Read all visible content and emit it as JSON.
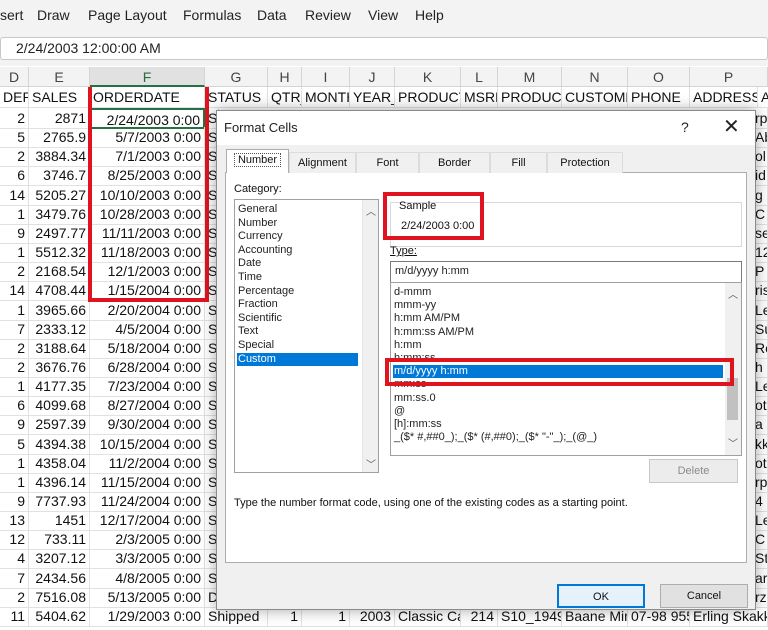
{
  "menu": [
    "sert",
    "Draw",
    "Page Layout",
    "Formulas",
    "Data",
    "Review",
    "View",
    "Help"
  ],
  "formula_bar": {
    "value": "2/24/2003 12:00:00 AM"
  },
  "columns": [
    "D",
    "E",
    "F",
    "G",
    "H",
    "I",
    "J",
    "K",
    "L",
    "M",
    "N",
    "O",
    "P"
  ],
  "headers": [
    "DER",
    "SALES",
    "ORDERDATE",
    "STATUS",
    "QTR_",
    "MONTH",
    "YEAR_II",
    "PRODUCTI",
    "MSRP",
    "PRODUCTC",
    "CUSTOMEI",
    "PHONE",
    "ADDRESSL",
    "A"
  ],
  "rows": [
    {
      "d": "2",
      "e": "2871",
      "f": "2/24/2003 0:00",
      "g": "S",
      "p": "rp"
    },
    {
      "d": "5",
      "e": "2765.9",
      "f": "5/7/2003 0:00",
      "g": "S",
      "p": "Ab"
    },
    {
      "d": "2",
      "e": "3884.34",
      "f": "7/1/2003 0:00",
      "g": "S",
      "p": "ol"
    },
    {
      "d": "6",
      "e": "3746.7",
      "f": "8/25/2003 0:00",
      "g": "S",
      "p": "id"
    },
    {
      "d": "14",
      "e": "5205.27",
      "f": "10/10/2003 0:00",
      "g": "S",
      "p": "g S"
    },
    {
      "d": "1",
      "e": "3479.76",
      "f": "10/28/2003 0:00",
      "g": "S",
      "p": "C"
    },
    {
      "d": "9",
      "e": "2497.77",
      "f": "11/11/2003 0:00",
      "g": "S",
      "p": "se"
    },
    {
      "d": "1",
      "e": "5512.32",
      "f": "11/18/2003 0:00",
      "g": "S",
      "p": "12"
    },
    {
      "d": "2",
      "e": "2168.54",
      "f": "12/1/2003 0:00",
      "g": "S",
      "p": "P"
    },
    {
      "d": "14",
      "e": "4708.44",
      "f": "1/15/2004 0:00",
      "g": "S",
      "p": "ris"
    },
    {
      "d": "1",
      "e": "3965.66",
      "f": "2/20/2004 0:00",
      "g": "S",
      "p": "Le"
    },
    {
      "d": "7",
      "e": "2333.12",
      "f": "4/5/2004 0:00",
      "g": "S",
      "p": "Su"
    },
    {
      "d": "2",
      "e": "3188.64",
      "f": "5/18/2004 0:00",
      "g": "S",
      "p": "Re"
    },
    {
      "d": "2",
      "e": "3676.76",
      "f": "6/28/2004 0:00",
      "g": "S",
      "p": "h"
    },
    {
      "d": "1",
      "e": "4177.35",
      "f": "7/23/2004 0:00",
      "g": "S",
      "p": "Le"
    },
    {
      "d": "6",
      "e": "4099.68",
      "f": "8/27/2004 0:00",
      "g": "S",
      "p": "otr"
    },
    {
      "d": "9",
      "e": "2597.39",
      "f": "9/30/2004 0:00",
      "g": "S",
      "p": "a 4"
    },
    {
      "d": "5",
      "e": "4394.38",
      "f": "10/15/2004 0:00",
      "g": "S",
      "p": "kke"
    },
    {
      "d": "1",
      "e": "4358.04",
      "f": "11/2/2004 0:00",
      "g": "S",
      "p": "oto"
    },
    {
      "d": "1",
      "e": "4396.14",
      "f": "11/15/2004 0:00",
      "g": "S",
      "p": "rp"
    },
    {
      "d": "9",
      "e": "7737.93",
      "f": "11/24/2004 0:00",
      "g": "S",
      "p": "4"
    },
    {
      "d": "13",
      "e": "1451",
      "f": "12/17/2004 0:00",
      "g": "S",
      "p": "Le"
    },
    {
      "d": "12",
      "e": "733.11",
      "f": "2/3/2005 0:00",
      "g": "S",
      "p": "C"
    },
    {
      "d": "4",
      "e": "3207.12",
      "f": "3/3/2005 0:00",
      "g": "S",
      "p": "Str"
    },
    {
      "d": "7",
      "e": "2434.56",
      "f": "4/8/2005 0:00",
      "g": "S",
      "p": "ar"
    },
    {
      "d": "2",
      "e": "7516.08",
      "f": "5/13/2005 0:00",
      "g": "D",
      "p": "rza"
    }
  ],
  "partial_row": {
    "d": "11",
    "e": "5404.62",
    "f": "1/29/2003 0:00",
    "g": "Shipped",
    "h": "1",
    "i": "1",
    "j": "2003",
    "k": "Classic Ca",
    "l": "214",
    "m": "S10_1949",
    "n": "Baane Min",
    "o": "07-98 955",
    "p": "Erling Skakke"
  },
  "dialog": {
    "title": "Format Cells",
    "help": "?",
    "close": "✕",
    "tabs": [
      "Number",
      "Alignment",
      "Font",
      "Border",
      "Fill",
      "Protection"
    ],
    "category_label": "Category:",
    "categories": [
      "General",
      "Number",
      "Currency",
      "Accounting",
      "Date",
      "Time",
      "Percentage",
      "Fraction",
      "Scientific",
      "Text",
      "Special",
      "Custom"
    ],
    "selected_category": "Custom",
    "sample_label": "Sample",
    "sample_value": "2/24/2003 0:00",
    "type_label": "Type:",
    "type_value": "m/d/yyyy h:mm",
    "type_list": [
      "d-mmm",
      "mmm-yy",
      "h:mm AM/PM",
      "h:mm:ss AM/PM",
      "h:mm",
      "h:mm:ss",
      "m/d/yyyy h:mm",
      "mm:ss",
      "mm:ss.0",
      "@",
      "[h]:mm:ss",
      "_($* #,##0_);_($* (#,##0);_($* \"-\"_);_(@_)"
    ],
    "selected_type": "m/d/yyyy h:mm",
    "delete_label": "Delete",
    "hint": "Type the number format code, using one of the existing codes as a starting point.",
    "ok_label": "OK",
    "cancel_label": "Cancel"
  },
  "colors": {
    "accent": "#217346",
    "highlight": "#e0141e",
    "selection": "#0078d7"
  }
}
